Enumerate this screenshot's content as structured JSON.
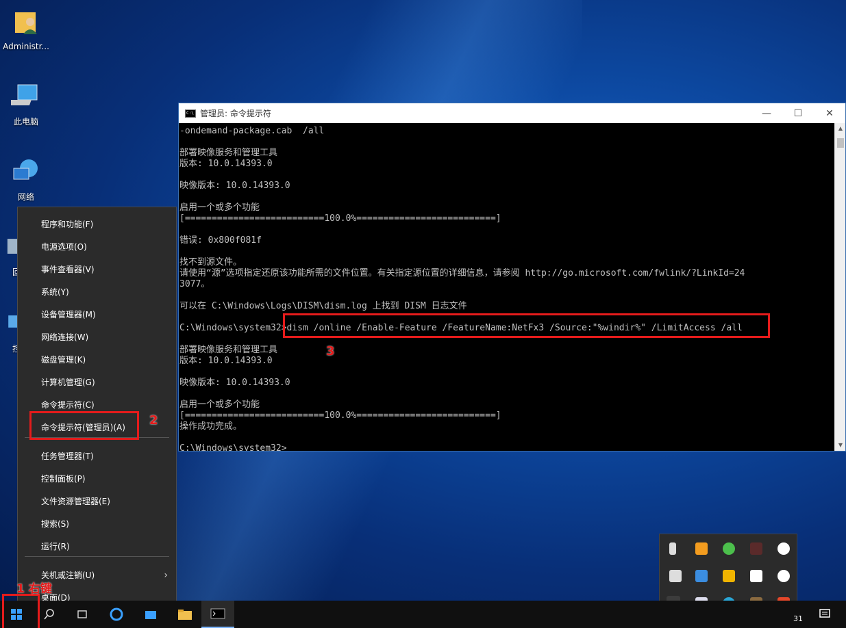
{
  "desktop": {
    "icons": [
      {
        "label": "Administr..."
      },
      {
        "label": "此电脑"
      },
      {
        "label": "网络"
      },
      {
        "label": "回"
      },
      {
        "label": "控"
      }
    ]
  },
  "console": {
    "title": "管理员: 命令提示符",
    "lines": [
      "-ondemand-package.cab  /all",
      "",
      "部署映像服务和管理工具",
      "版本: 10.0.14393.0",
      "",
      "映像版本: 10.0.14393.0",
      "",
      "启用一个或多个功能",
      "[==========================100.0%==========================]",
      "",
      "错误: 0x800f081f",
      "",
      "找不到源文件。",
      "请使用“源”选项指定还原该功能所需的文件位置。有关指定源位置的详细信息，请参阅 http://go.microsoft.com/fwlink/?LinkId=24",
      "3077。",
      "",
      "可以在 C:\\Windows\\Logs\\DISM\\dism.log 上找到 DISM 日志文件",
      "",
      "C:\\Windows\\system32>dism /online /Enable-Feature /FeatureName:NetFx3 /Source:\"%windir%\" /LimitAccess /all",
      "",
      "部署映像服务和管理工具",
      "版本: 10.0.14393.0",
      "",
      "映像版本: 10.0.14393.0",
      "",
      "启用一个或多个功能",
      "[==========================100.0%==========================]",
      "操作成功完成。",
      "",
      "C:\\Windows\\system32>"
    ]
  },
  "context_menu": {
    "items": [
      "程序和功能(F)",
      "电源选项(O)",
      "事件查看器(V)",
      "系统(Y)",
      "设备管理器(M)",
      "网络连接(W)",
      "磁盘管理(K)",
      "计算机管理(G)",
      "命令提示符(C)",
      "命令提示符(管理员)(A)",
      "任务管理器(T)",
      "控制面板(P)",
      "文件资源管理器(E)",
      "搜索(S)",
      "运行(R)",
      "关机或注销(U)",
      "桌面(D)"
    ]
  },
  "annotations": {
    "step1": "1 右键",
    "step2": "2",
    "step3": "3",
    "color": "#e51b1b"
  },
  "taskbar": {
    "clock_fragment": "31"
  }
}
